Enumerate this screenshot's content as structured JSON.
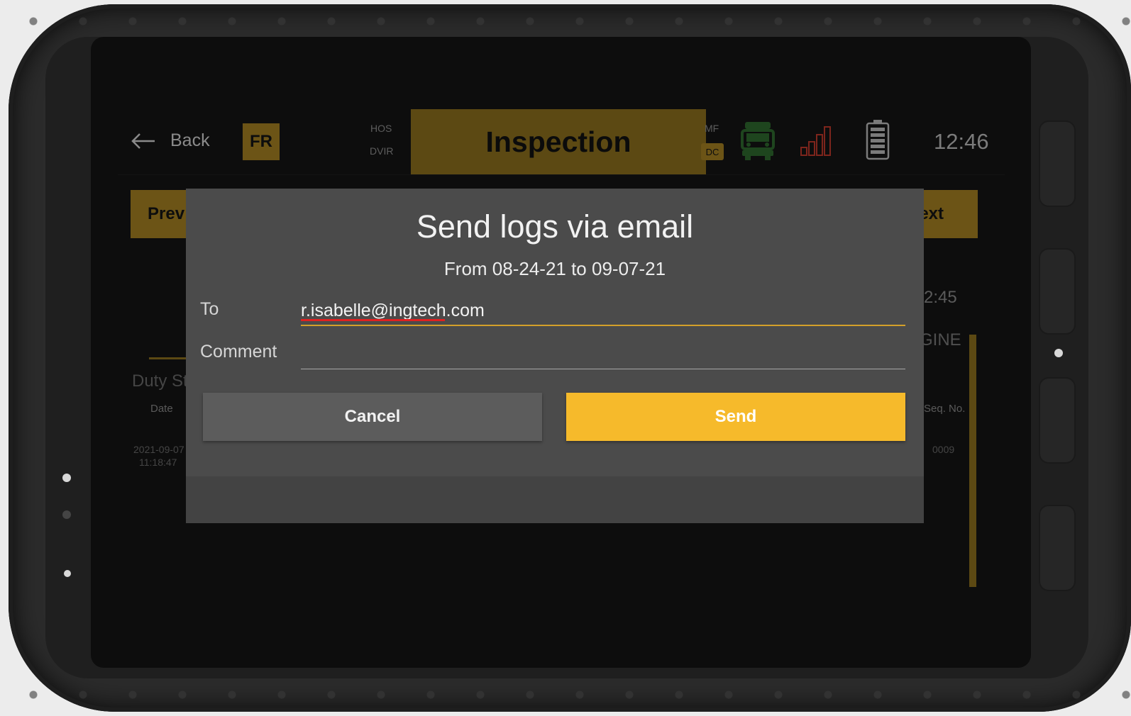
{
  "topbar": {
    "back_label": "Back",
    "language_badge": "FR",
    "hos_label": "HOS",
    "dvir_label": "DVIR",
    "active_tab": "Inspection",
    "mf_label": "MF",
    "dc_label": "DC",
    "time": "12:46",
    "icons": [
      "back-arrow-icon",
      "truck-icon",
      "signal-icon",
      "battery-icon"
    ],
    "colors": {
      "accent": "#a68222",
      "truck": "#2f6b2f",
      "signal": "#c0392b"
    }
  },
  "background": {
    "prev_label": "Prev",
    "next_label": "ext",
    "time_partial": "2:45",
    "engine_partial": "GINE",
    "duty_status_partial": "Duty St",
    "date_header": "Date",
    "seq_header": "Seq. No.",
    "row_date": "2021-09-07",
    "row_time": "11:18:47",
    "row_seq": "0009"
  },
  "dialog": {
    "title": "Send logs via email",
    "subtitle": "From 08-24-21 to 09-07-21",
    "to_label": "To",
    "to_value": "r.isabelle@ingtech.com",
    "comment_label": "Comment",
    "comment_value": "",
    "cancel_label": "Cancel",
    "send_label": "Send",
    "colors": {
      "send": "#f6ba2b",
      "cancel": "#5c5c5c"
    }
  }
}
